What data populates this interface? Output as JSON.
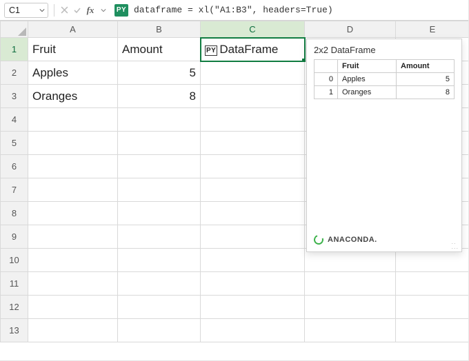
{
  "colors": {
    "accent": "#107c41",
    "pyChip": "#1f8f5f",
    "anaconda": "#3db24b"
  },
  "formulaBar": {
    "nameBox": "C1",
    "pyChipLabel": "PY",
    "code": "dataframe = xl(\"A1:B3\", headers=True)"
  },
  "columns": [
    "A",
    "B",
    "C",
    "D",
    "E"
  ],
  "rows": [
    "1",
    "2",
    "3",
    "4",
    "5",
    "6",
    "7",
    "8",
    "9",
    "10",
    "11",
    "12",
    "13"
  ],
  "activeCell": "C1",
  "cells": {
    "A1": "Fruit",
    "B1": "Amount",
    "C1_prefix": "PY",
    "C1": "DataFrame",
    "A2": "Apples",
    "B2": "5",
    "A3": "Oranges",
    "B3": "8"
  },
  "preview": {
    "title": "2x2 DataFrame",
    "headers": [
      "Fruit",
      "Amount"
    ],
    "rows": [
      {
        "index": "0",
        "fruit": "Apples",
        "amount": "5"
      },
      {
        "index": "1",
        "fruit": "Oranges",
        "amount": "8"
      }
    ],
    "branding": "ANACONDA."
  },
  "chart_data": {
    "type": "table",
    "title": "2x2 DataFrame",
    "columns": [
      "Fruit",
      "Amount"
    ],
    "rows": [
      [
        "Apples",
        5
      ],
      [
        "Oranges",
        8
      ]
    ]
  }
}
